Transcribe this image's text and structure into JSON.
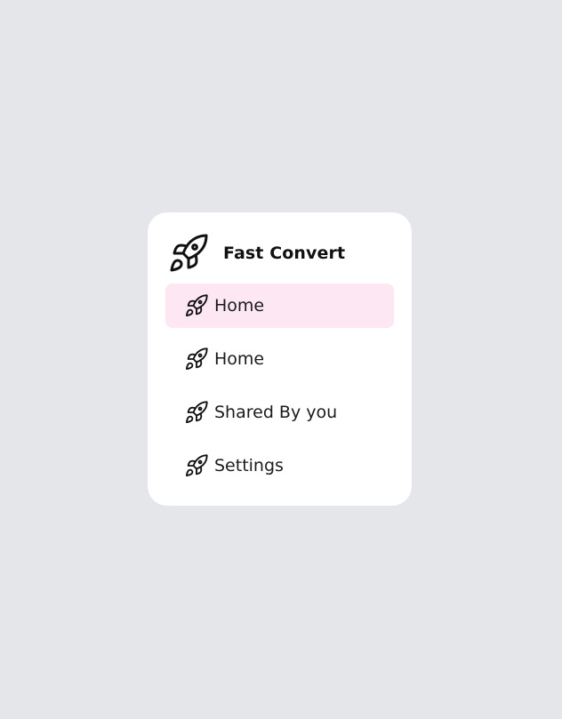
{
  "app": {
    "title": "Fast Convert",
    "logo_icon": "rocket-icon"
  },
  "nav": {
    "items": [
      {
        "label": "Home",
        "icon": "rocket-icon",
        "active": true
      },
      {
        "label": "Home",
        "icon": "rocket-icon",
        "active": false
      },
      {
        "label": "Shared By you",
        "icon": "rocket-icon",
        "active": false
      },
      {
        "label": "Settings",
        "icon": "rocket-icon",
        "active": false
      }
    ]
  },
  "colors": {
    "background": "#e5e6ea",
    "card": "#ffffff",
    "active_highlight": "#fce7f3",
    "text": "#1b1b1b"
  }
}
